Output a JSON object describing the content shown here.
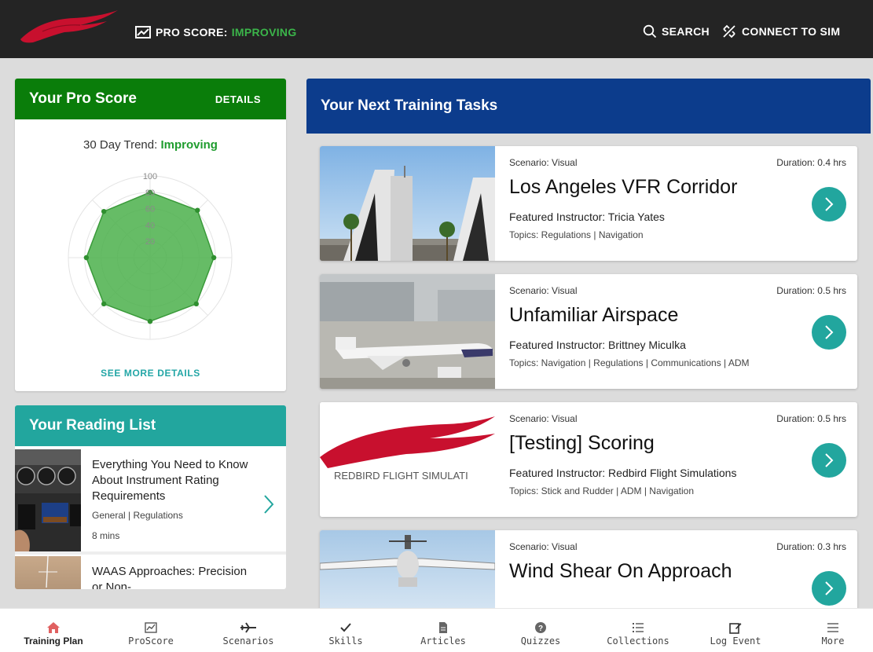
{
  "header": {
    "pro_score_label": "PRO SCORE:",
    "pro_score_status": "IMPROVING",
    "search_label": "SEARCH",
    "connect_label": "CONNECT TO SIM"
  },
  "pro_score_card": {
    "title": "Your Pro Score",
    "details_label": "DETAILS",
    "trend_label": "30 Day Trend:",
    "trend_value": "Improving",
    "radar": {
      "ticks": [
        "20",
        "40",
        "60",
        "80",
        "100"
      ],
      "values": [
        80,
        82,
        78,
        80,
        78,
        80,
        78,
        80
      ]
    },
    "see_more_label": "SEE MORE DETAILS"
  },
  "reading_list": {
    "title": "Your Reading List",
    "items": [
      {
        "title": "Everything You Need to Know About Instrument Rating Requirements",
        "meta": "General | Regulations",
        "time": "8 mins"
      },
      {
        "title": "WAAS Approaches: Precision or Non-",
        "meta": "",
        "time": ""
      }
    ]
  },
  "training": {
    "title": "Your Next Training Tasks",
    "tasks": [
      {
        "scenario": "Scenario:  Visual",
        "duration": "Duration: 0.4 hrs",
        "title": "Los Angeles VFR Corridor",
        "instructor": "Featured Instructor: Tricia Yates",
        "topics": "Topics: Regulations | Navigation"
      },
      {
        "scenario": "Scenario:  Visual",
        "duration": "Duration: 0.5 hrs",
        "title": "Unfamiliar Airspace",
        "instructor": "Featured Instructor: Brittney Miculka",
        "topics": "Topics: Navigation | Regulations | Communications | ADM"
      },
      {
        "scenario": "Scenario:  Visual",
        "duration": "Duration: 0.5 hrs",
        "title": "[Testing] Scoring",
        "instructor": "Featured Instructor: Redbird Flight Simulations",
        "topics": "Topics: Stick and Rudder | ADM | Navigation",
        "thumb_text": "REDBIRD FLIGHT SIMULATI"
      },
      {
        "scenario": "Scenario:  Visual",
        "duration": "Duration: 0.3 hrs",
        "title": "Wind Shear On Approach",
        "instructor": "",
        "topics": ""
      }
    ]
  },
  "nav": {
    "items": [
      {
        "label": "Training Plan",
        "icon": "home-icon"
      },
      {
        "label": "ProScore",
        "icon": "chart-icon"
      },
      {
        "label": "Scenarios",
        "icon": "airplane-icon"
      },
      {
        "label": "Skills",
        "icon": "check-icon"
      },
      {
        "label": "Articles",
        "icon": "document-icon"
      },
      {
        "label": "Quizzes",
        "icon": "question-icon"
      },
      {
        "label": "Collections",
        "icon": "list-icon"
      },
      {
        "label": "Log Event",
        "icon": "edit-icon"
      },
      {
        "label": "More",
        "icon": "menu-icon"
      }
    ]
  },
  "colors": {
    "header_bg": "#242424",
    "accent_green": "#0a7d0a",
    "teal": "#22a69e",
    "navy": "#0c3c8c",
    "logo_red": "#c8102e"
  }
}
